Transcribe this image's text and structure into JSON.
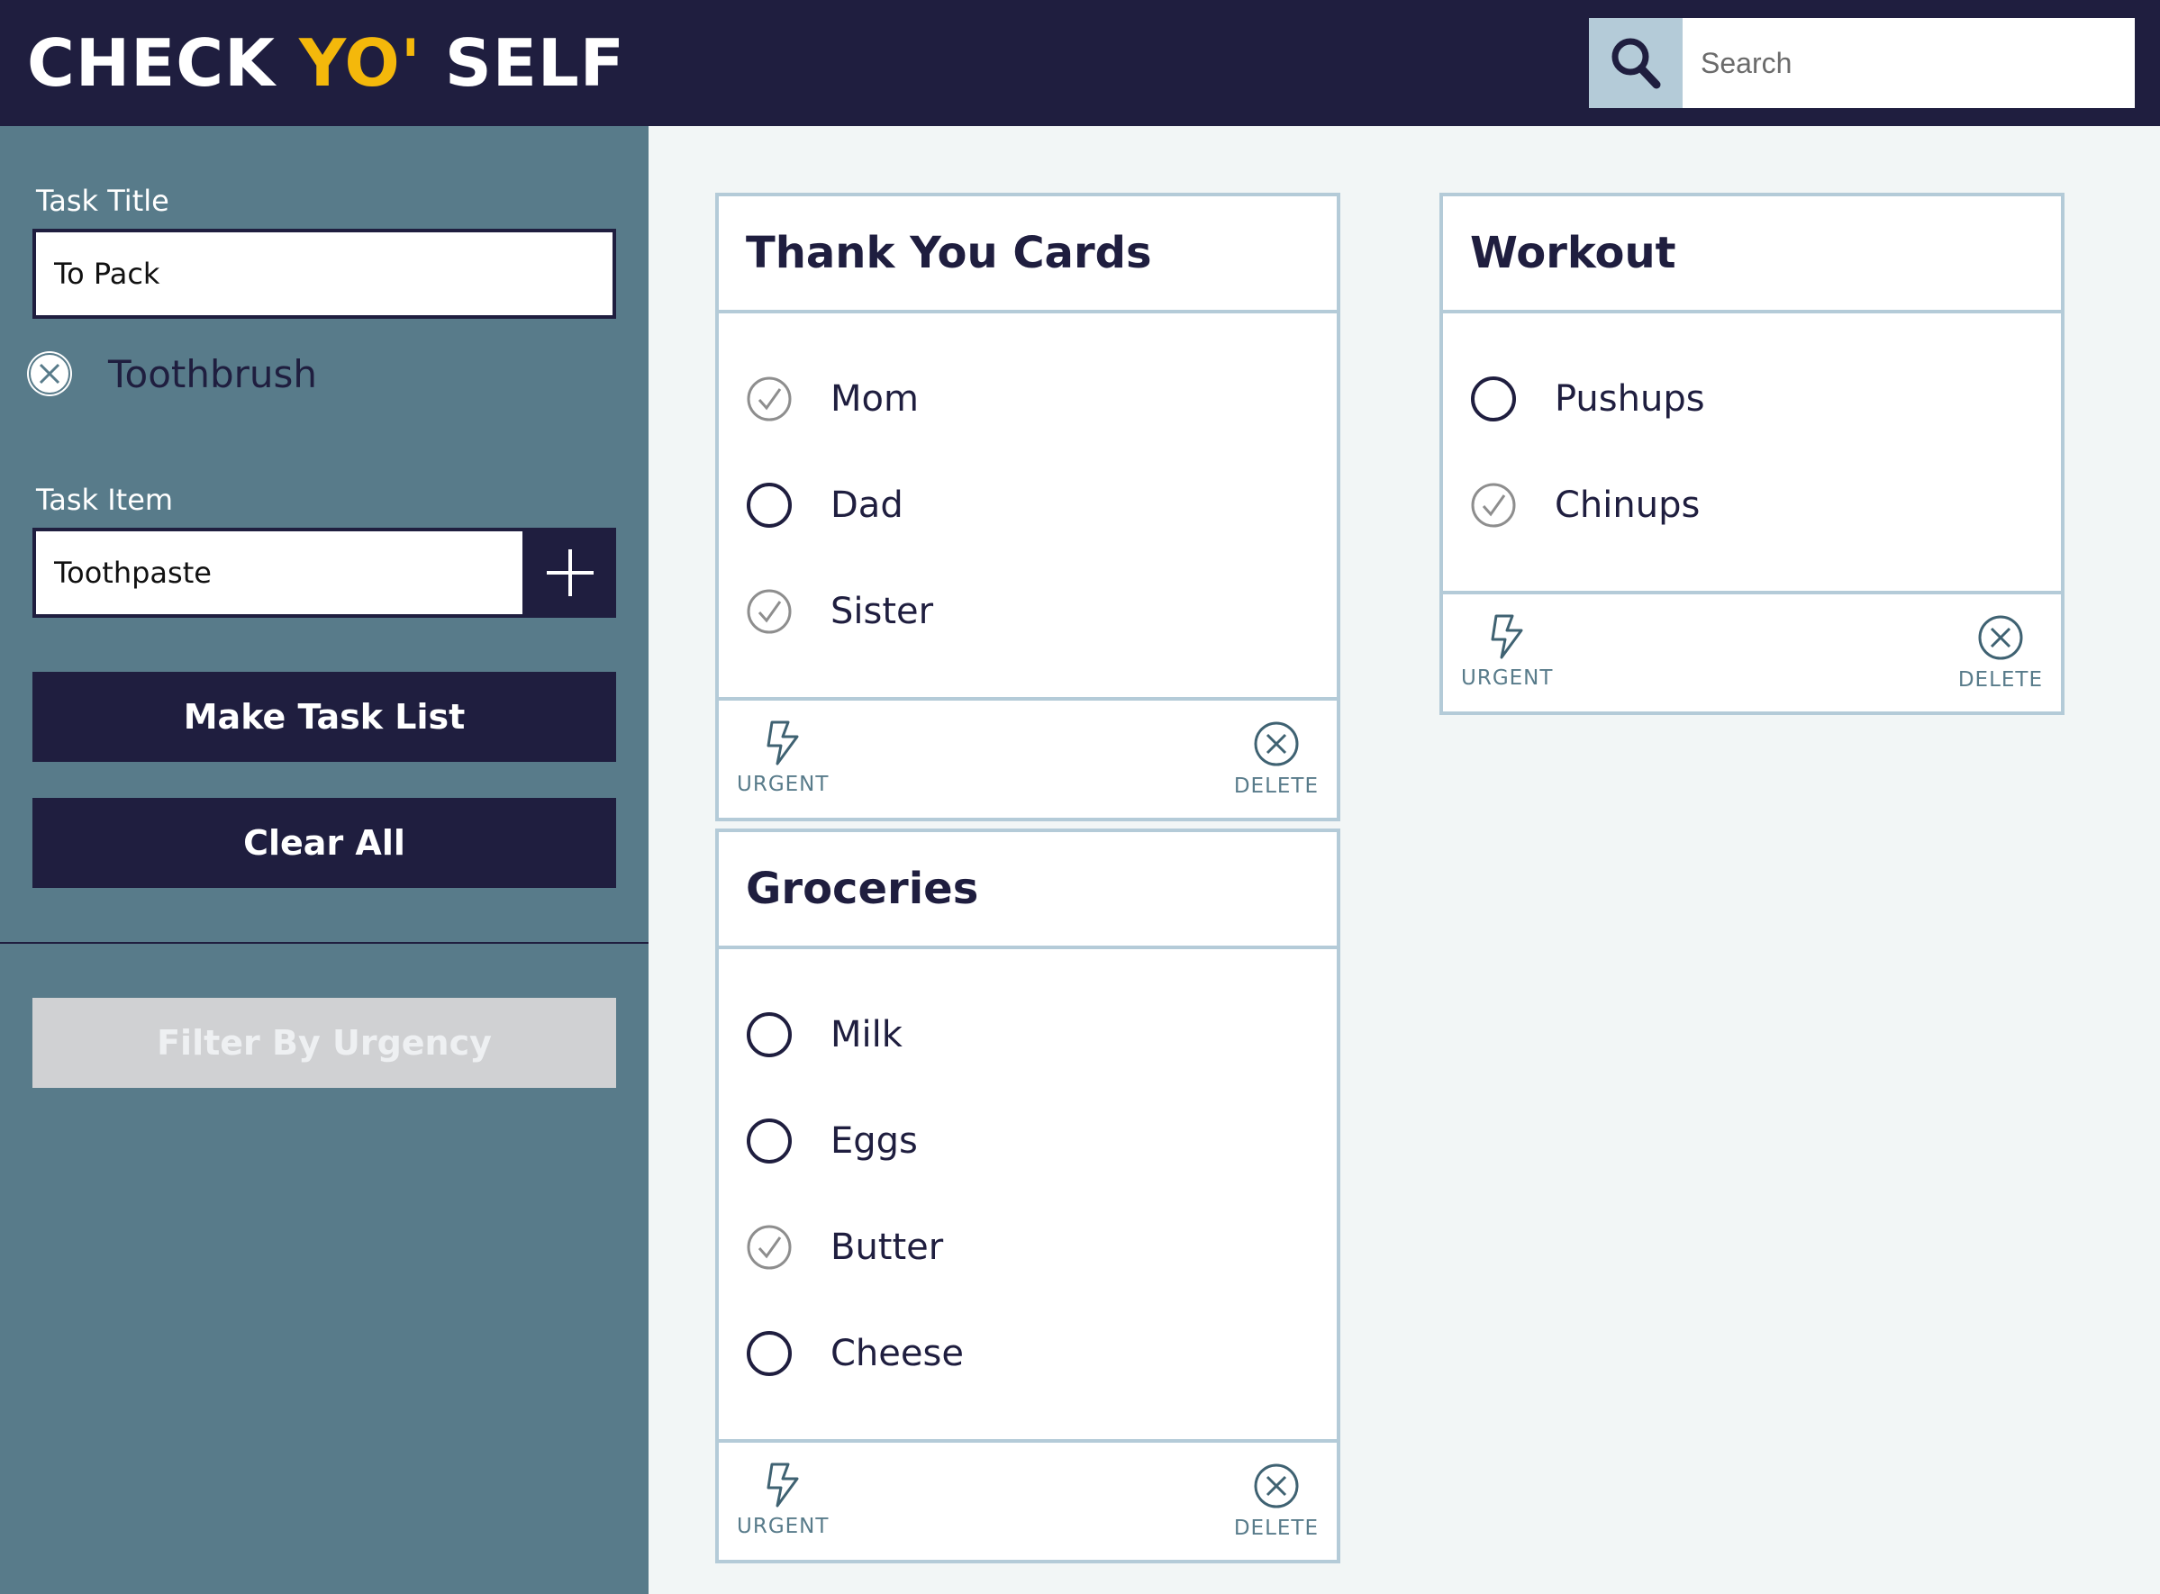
{
  "header": {
    "logo_part1": "CHECK ",
    "logo_accent": "YO'",
    "logo_part2": " SELF",
    "search_placeholder": "Search",
    "search_icon": "search-icon"
  },
  "sidebar": {
    "task_title_label": "Task Title",
    "task_title_value": "To Pack",
    "pending_items": [
      {
        "text": "Toothbrush",
        "icon": "close-circle-icon"
      }
    ],
    "task_item_label": "Task Item",
    "task_item_value": "Toothpaste",
    "add_icon": "plus-icon",
    "make_task_list_label": "Make Task List",
    "clear_all_label": "Clear All",
    "filter_label": "Filter By Urgency"
  },
  "cards": [
    {
      "title": "Thank You Cards",
      "tasks": [
        {
          "text": "Mom",
          "checked": true
        },
        {
          "text": "Dad",
          "checked": false
        },
        {
          "text": "Sister",
          "checked": true
        }
      ],
      "urgent_label": "URGENT",
      "delete_label": "DELETE"
    },
    {
      "title": "Groceries",
      "tasks": [
        {
          "text": "Milk",
          "checked": false
        },
        {
          "text": "Eggs",
          "checked": false
        },
        {
          "text": "Butter",
          "checked": true
        },
        {
          "text": "Cheese",
          "checked": false
        }
      ],
      "urgent_label": "URGENT",
      "delete_label": "DELETE"
    },
    {
      "title": "Workout",
      "tasks": [
        {
          "text": "Pushups",
          "checked": false
        },
        {
          "text": "Chinups",
          "checked": true
        }
      ],
      "urgent_label": "URGENT",
      "delete_label": "DELETE"
    }
  ],
  "colors": {
    "navy": "#1f1e3f",
    "accent": "#f4b80b",
    "sidebar": "#587b8a",
    "card_border": "#b4cbd8",
    "background": "#f2f6f6"
  }
}
